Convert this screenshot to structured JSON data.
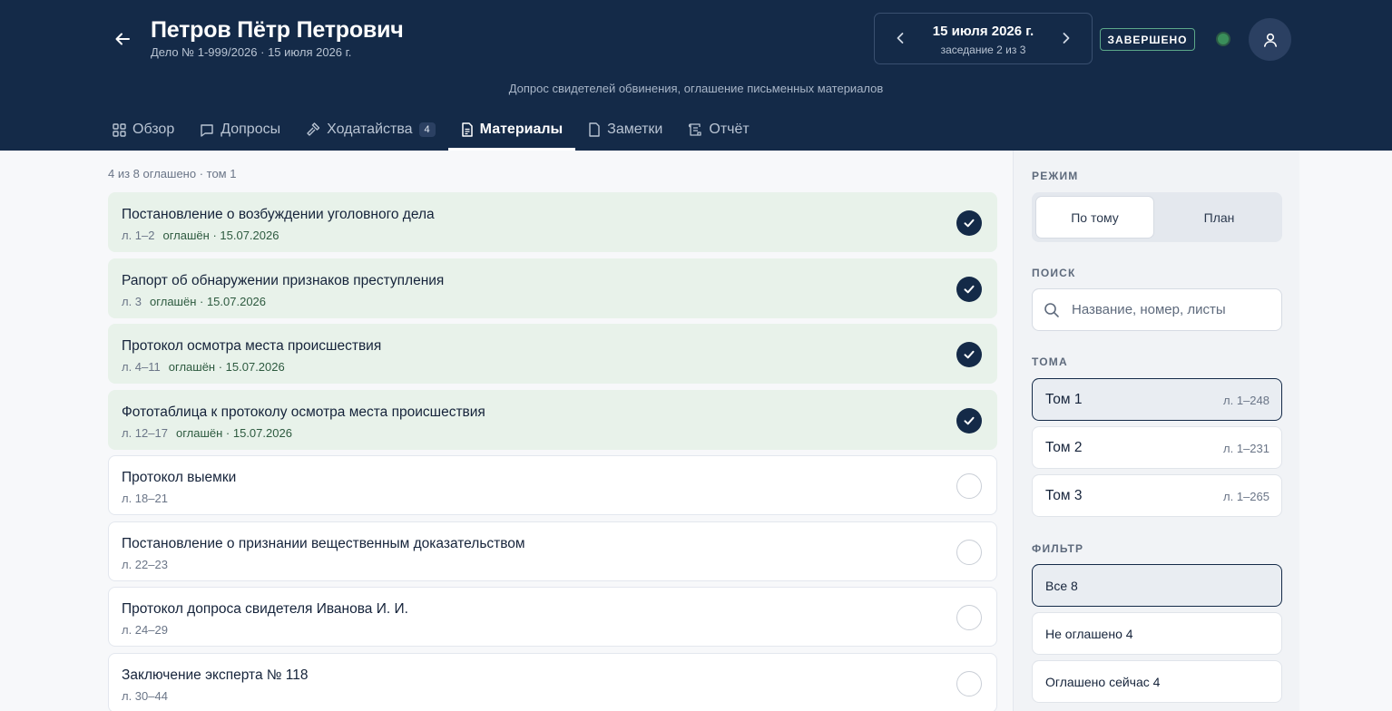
{
  "header": {
    "title": "Петров Пётр Петрович",
    "subtitle": "Дело № 1-999/2026 · 15 июля 2026 г.",
    "date": "15 июля 2026 г.",
    "session": "заседание 2 из 3",
    "status": "ЗАВЕРШЕНО",
    "description": "Допрос свидетелей обвинения, оглашение письменных материалов"
  },
  "tabs": [
    {
      "label": "Обзор",
      "icon": "grid-icon"
    },
    {
      "label": "Допросы",
      "icon": "chat-icon"
    },
    {
      "label": "Ходатайства",
      "icon": "gavel-icon",
      "count": "4"
    },
    {
      "label": "Материалы",
      "icon": "document-icon",
      "active": true
    },
    {
      "label": "Заметки",
      "icon": "note-icon"
    },
    {
      "label": "Отчёт",
      "icon": "scroll-icon"
    }
  ],
  "list": {
    "summary": "4 из 8 оглашено · том 1",
    "items": [
      {
        "title": "Постановление о возбуждении уголовного дела",
        "pages": "л. 1–2",
        "status": "оглашён · 15.07.2026",
        "read": true
      },
      {
        "title": "Рапорт об обнаружении признаков преступления",
        "pages": "л. 3",
        "status": "оглашён · 15.07.2026",
        "read": true
      },
      {
        "title": "Протокол осмотра места происшествия",
        "pages": "л. 4–11",
        "status": "оглашён · 15.07.2026",
        "read": true
      },
      {
        "title": "Фототаблица к протоколу осмотра места происшествия",
        "pages": "л. 12–17",
        "status": "оглашён · 15.07.2026",
        "read": true
      },
      {
        "title": "Протокол выемки",
        "pages": "л. 18–21",
        "status": "",
        "read": false
      },
      {
        "title": "Постановление о признании вещественным доказательством",
        "pages": "л. 22–23",
        "status": "",
        "read": false
      },
      {
        "title": "Протокол допроса свидетеля Иванова И. И.",
        "pages": "л. 24–29",
        "status": "",
        "read": false
      },
      {
        "title": "Заключение эксперта № 118",
        "pages": "л. 30–44",
        "status": "",
        "read": false
      }
    ]
  },
  "sidebar": {
    "mode_label": "РЕЖИМ",
    "mode_options": [
      "По тому",
      "План"
    ],
    "search_label": "ПОИСК",
    "search_placeholder": "Название, номер, листы",
    "volumes_label": "ТОМА",
    "volumes": [
      {
        "name": "Том 1",
        "range": "л. 1–248",
        "active": true
      },
      {
        "name": "Том 2",
        "range": "л. 1–231"
      },
      {
        "name": "Том 3",
        "range": "л. 1–265"
      }
    ],
    "filter_label": "ФИЛЬТР",
    "filters": [
      {
        "label": "Все 8",
        "active": true
      },
      {
        "label": "Не оглашено 4"
      },
      {
        "label": "Оглашено сейчас 4"
      }
    ]
  },
  "colors": {
    "header_bg": "#142a48",
    "read_bg": "#e8f2ea",
    "status_green": "#3a8e5a"
  }
}
